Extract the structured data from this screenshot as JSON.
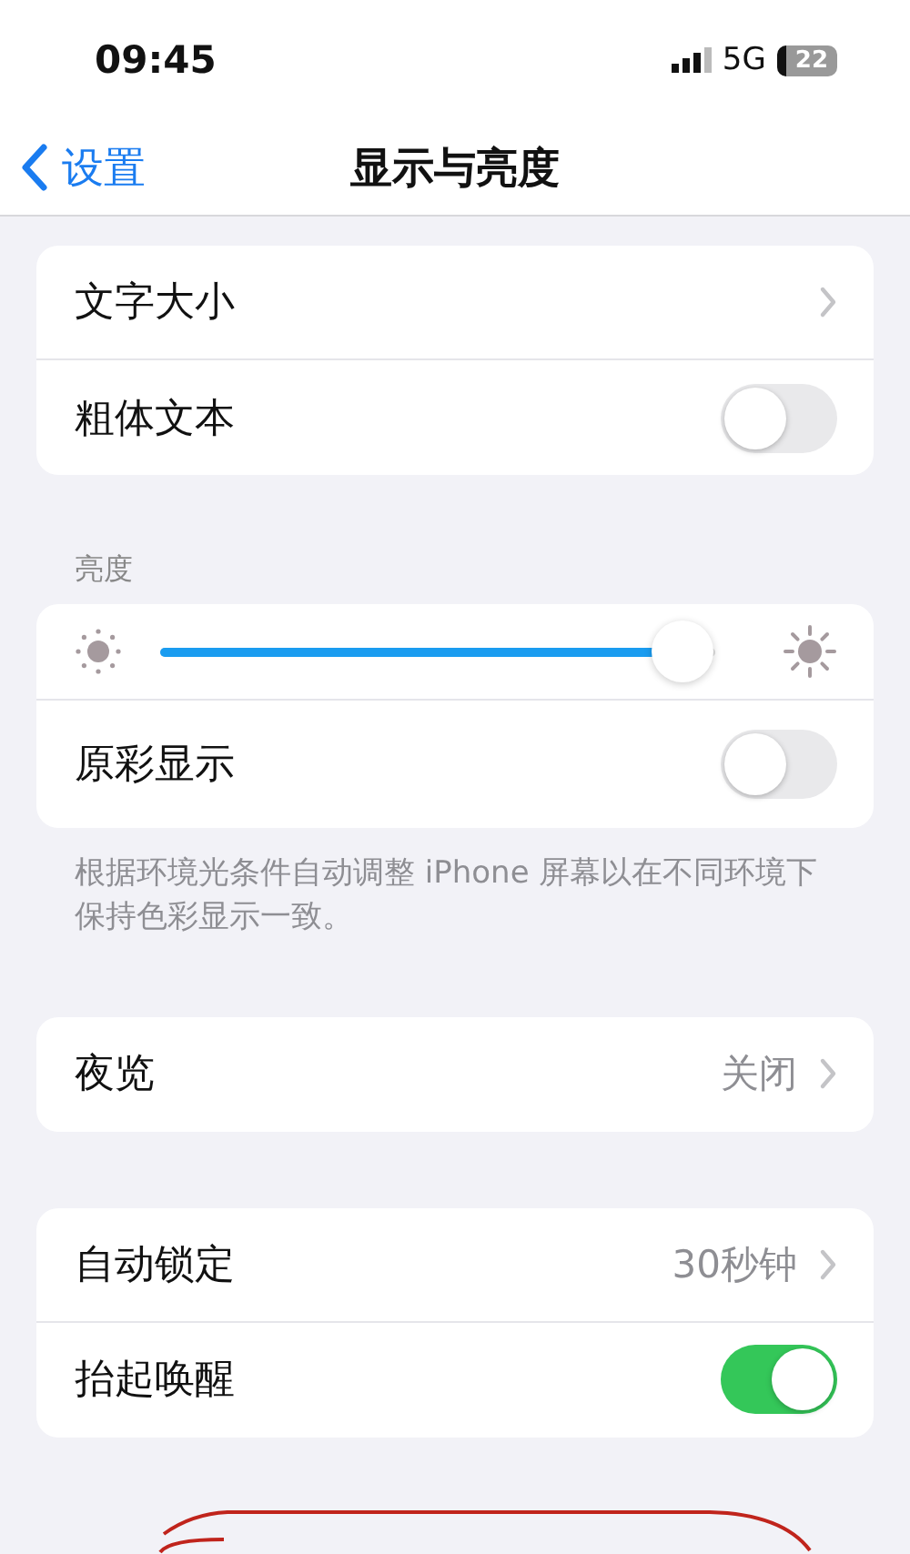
{
  "status_bar": {
    "time": "09:45",
    "network": "5G",
    "battery": "22"
  },
  "nav": {
    "back": "设置",
    "title": "显示与亮度"
  },
  "sections": [
    {
      "rows": [
        {
          "kind": "link",
          "label": "文字大小"
        },
        {
          "kind": "toggle",
          "label": "粗体文本",
          "on": false
        }
      ]
    },
    {
      "header": "亮度",
      "footer": "根据环境光条件自动调整 iPhone 屏幕以在不同环境下保持色彩显示一致。",
      "rows": [
        {
          "kind": "slider",
          "level": 0.94
        },
        {
          "kind": "toggle",
          "label": "原彩显示",
          "on": false
        }
      ]
    },
    {
      "rows": [
        {
          "kind": "link",
          "label": "夜览",
          "value": "关闭"
        }
      ]
    },
    {
      "rows": [
        {
          "kind": "link",
          "label": "自动锁定",
          "value": "30秒钟"
        },
        {
          "kind": "toggle",
          "label": "抬起唤醒",
          "on": true
        }
      ]
    }
  ]
}
